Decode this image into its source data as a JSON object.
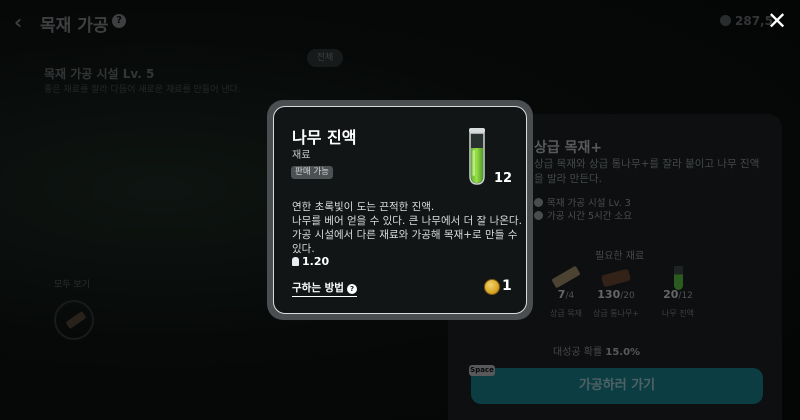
{
  "topbar": {
    "title": "목재 가공",
    "currency_value": "287,5"
  },
  "background": {
    "tab_pill": "전체",
    "facility_title": "목재 가공 시설 Lv. 5",
    "facility_desc": "좋은 재료를 잘라 다듬어 새로운 재료를 만들어 낸다.",
    "all_view": "모두 보기"
  },
  "recipe_panel": {
    "title": "상급 목재+",
    "description": "상급 목재와 상급 통나무+를 잘라 붙이고 나무 진액을 발라 만든다.",
    "facility": "목재 가공 시설 Lv. 3",
    "time": "가공 시간 5시간 소요",
    "required_title": "필요한 재료",
    "materials": [
      {
        "have": "7",
        "need": "/4",
        "name": "상급 목재",
        "icon": "plank-icon"
      },
      {
        "have": "130",
        "need": "/20",
        "name": "상급 통나무+",
        "icon": "log-icon"
      },
      {
        "have": "20",
        "need": "/12",
        "name": "나무 진액",
        "icon": "test-tube-icon"
      }
    ],
    "success_rate_label": "대성공 확률",
    "success_rate_value": "15.0%",
    "space_key": "Space",
    "go_button": "가공하러 가기"
  },
  "popup": {
    "item_name": "나무 진액",
    "item_type": "재료",
    "sellable": "판매 가능",
    "count": "12",
    "description_lines": [
      "연한 초록빛이 도는 끈적한 진액.",
      "나무를 베어 얻을 수 있다. 큰 나무에서 더 잘 나온다.",
      "가공 시설에서 다른 재료와 가공해 목재+로 만들 수",
      "있다."
    ],
    "weight": "1.20",
    "how_to_get": "구하는 방법",
    "price": "1"
  },
  "colors": {
    "accent_button": "#146f7a",
    "liquid_green": "#7bd23a"
  }
}
